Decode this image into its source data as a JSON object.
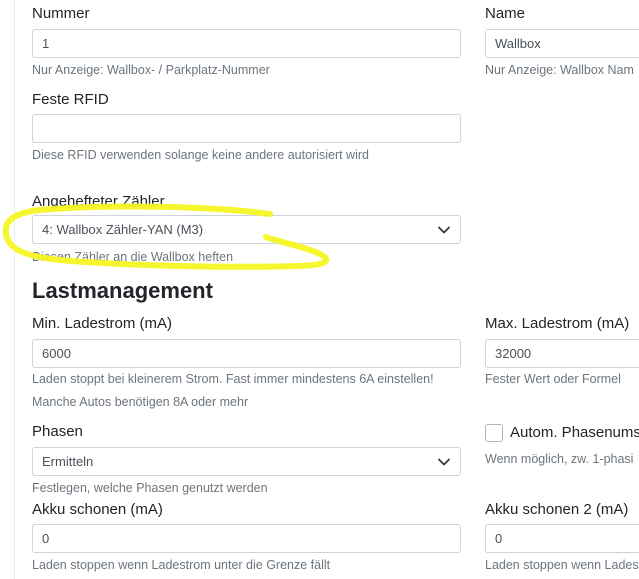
{
  "colors": {
    "highlight": "#f5f523",
    "help_text": "#6c757d",
    "border": "#ced4da"
  },
  "wallbox": {
    "nummer": {
      "label": "Nummer",
      "value": "1",
      "help": "Nur Anzeige: Wallbox- / Parkplatz-Nummer"
    },
    "name": {
      "label": "Name",
      "value": "Wallbox",
      "help": "Nur Anzeige: Wallbox Nam"
    },
    "rfid": {
      "label": "Feste RFID",
      "value": "",
      "help": "Diese RFID verwenden solange keine andere autorisiert wird"
    },
    "meter": {
      "label": "Angehefteter Zähler",
      "selected": "4: Wallbox Zähler-YAN (M3)",
      "help": "Diesen Zähler an die Wallbox heften"
    }
  },
  "lastmanagement": {
    "heading": "Lastmanagement",
    "min_current": {
      "label": "Min. Ladestrom (mA)",
      "value": "6000",
      "help1": "Laden stoppt bei kleinerem Strom. Fast immer mindestens 6A einstellen!",
      "help2": "Manche Autos benötigen 8A oder mehr"
    },
    "max_current": {
      "label": "Max. Ladestrom (mA)",
      "value": "32000",
      "help": "Fester Wert oder Formel"
    },
    "phases": {
      "label": "Phasen",
      "selected": "Ermitteln",
      "help": "Festlegen, welche Phasen genutzt werden"
    },
    "auto_phase_switch": {
      "label": "Autom. Phasenumsc",
      "checked": false,
      "help": "Wenn möglich, zw. 1-phasi"
    },
    "akku1": {
      "label": "Akku schonen (mA)",
      "value": "0",
      "help": "Laden stoppen wenn Ladestrom unter die Grenze fällt"
    },
    "akku2": {
      "label": "Akku schonen 2 (mA)",
      "value": "0",
      "help": "Laden stoppen wenn Lades"
    }
  }
}
